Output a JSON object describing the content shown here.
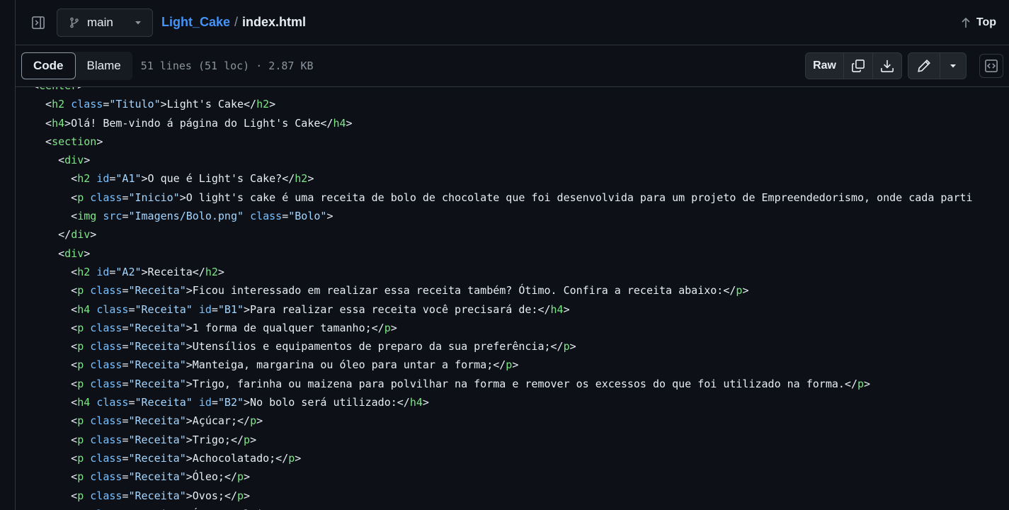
{
  "header": {
    "branch": "main",
    "repo": "Light_Cake",
    "separator": "/",
    "file": "index.html",
    "top_label": "Top"
  },
  "toolbar": {
    "tabs": [
      "Code",
      "Blame"
    ],
    "active_tab": "Code",
    "meta": "51 lines (51 loc) · 2.87 KB",
    "raw_label": "Raw"
  },
  "icons": {
    "sidebar": "sidebar-expand-icon",
    "branch": "git-branch-icon",
    "caret": "triangle-down-icon",
    "top": "arrow-up-icon",
    "copy": "copy-icon",
    "download": "download-icon",
    "edit": "pencil-icon",
    "more": "triangle-down-icon",
    "symbols": "code-square-icon"
  },
  "colors": {
    "background": "#0d1117",
    "tag": "#7ee787",
    "attr": "#79c0ff",
    "string": "#a5d6ff",
    "link": "#4493f8",
    "muted": "#8b949e",
    "border": "#30363d"
  },
  "code_lines": [
    [
      {
        "t": "<",
        "c": "txt"
      },
      {
        "t": "center",
        "c": "tag"
      },
      {
        "t": ">",
        "c": "txt"
      }
    ],
    [
      {
        "t": "  <",
        "c": "txt"
      },
      {
        "t": "h2",
        "c": "tag"
      },
      {
        "t": " ",
        "c": "txt"
      },
      {
        "t": "class",
        "c": "attr"
      },
      {
        "t": "=",
        "c": "txt"
      },
      {
        "t": "\"Titulo\"",
        "c": "str"
      },
      {
        "t": ">Light's Cake</",
        "c": "txt"
      },
      {
        "t": "h2",
        "c": "tag"
      },
      {
        "t": ">",
        "c": "txt"
      }
    ],
    [
      {
        "t": "  <",
        "c": "txt"
      },
      {
        "t": "h4",
        "c": "tag"
      },
      {
        "t": ">Olá! Bem-vindo á página do Light's Cake</",
        "c": "txt"
      },
      {
        "t": "h4",
        "c": "tag"
      },
      {
        "t": ">",
        "c": "txt"
      }
    ],
    [
      {
        "t": "  <",
        "c": "txt"
      },
      {
        "t": "section",
        "c": "tag"
      },
      {
        "t": ">",
        "c": "txt"
      }
    ],
    [
      {
        "t": "    <",
        "c": "txt"
      },
      {
        "t": "div",
        "c": "tag"
      },
      {
        "t": ">",
        "c": "txt"
      }
    ],
    [
      {
        "t": "      <",
        "c": "txt"
      },
      {
        "t": "h2",
        "c": "tag"
      },
      {
        "t": " ",
        "c": "txt"
      },
      {
        "t": "id",
        "c": "attr"
      },
      {
        "t": "=",
        "c": "txt"
      },
      {
        "t": "\"A1\"",
        "c": "str"
      },
      {
        "t": ">O que é Light's Cake?</",
        "c": "txt"
      },
      {
        "t": "h2",
        "c": "tag"
      },
      {
        "t": ">",
        "c": "txt"
      }
    ],
    [
      {
        "t": "      <",
        "c": "txt"
      },
      {
        "t": "p",
        "c": "tag"
      },
      {
        "t": " ",
        "c": "txt"
      },
      {
        "t": "class",
        "c": "attr"
      },
      {
        "t": "=",
        "c": "txt"
      },
      {
        "t": "\"Inicio\"",
        "c": "str"
      },
      {
        "t": ">O light's cake é uma receita de bolo de chocolate que foi desenvolvida para um projeto de Empreendedorismo, onde cada parti",
        "c": "txt"
      }
    ],
    [
      {
        "t": "      <",
        "c": "txt"
      },
      {
        "t": "img",
        "c": "tag"
      },
      {
        "t": " ",
        "c": "txt"
      },
      {
        "t": "src",
        "c": "attr"
      },
      {
        "t": "=",
        "c": "txt"
      },
      {
        "t": "\"Imagens/Bolo.png\"",
        "c": "str"
      },
      {
        "t": " ",
        "c": "txt"
      },
      {
        "t": "class",
        "c": "attr"
      },
      {
        "t": "=",
        "c": "txt"
      },
      {
        "t": "\"Bolo\"",
        "c": "str"
      },
      {
        "t": ">",
        "c": "txt"
      }
    ],
    [
      {
        "t": "    </",
        "c": "txt"
      },
      {
        "t": "div",
        "c": "tag"
      },
      {
        "t": ">",
        "c": "txt"
      }
    ],
    [
      {
        "t": "    <",
        "c": "txt"
      },
      {
        "t": "div",
        "c": "tag"
      },
      {
        "t": ">",
        "c": "txt"
      }
    ],
    [
      {
        "t": "      <",
        "c": "txt"
      },
      {
        "t": "h2",
        "c": "tag"
      },
      {
        "t": " ",
        "c": "txt"
      },
      {
        "t": "id",
        "c": "attr"
      },
      {
        "t": "=",
        "c": "txt"
      },
      {
        "t": "\"A2\"",
        "c": "str"
      },
      {
        "t": ">Receita</",
        "c": "txt"
      },
      {
        "t": "h2",
        "c": "tag"
      },
      {
        "t": ">",
        "c": "txt"
      }
    ],
    [
      {
        "t": "      <",
        "c": "txt"
      },
      {
        "t": "p",
        "c": "tag"
      },
      {
        "t": " ",
        "c": "txt"
      },
      {
        "t": "class",
        "c": "attr"
      },
      {
        "t": "=",
        "c": "txt"
      },
      {
        "t": "\"Receita\"",
        "c": "str"
      },
      {
        "t": ">Ficou interessado em realizar essa receita também? Ótimo. Confira a receita abaixo:</",
        "c": "txt"
      },
      {
        "t": "p",
        "c": "tag"
      },
      {
        "t": ">",
        "c": "txt"
      }
    ],
    [
      {
        "t": "      <",
        "c": "txt"
      },
      {
        "t": "h4",
        "c": "tag"
      },
      {
        "t": " ",
        "c": "txt"
      },
      {
        "t": "class",
        "c": "attr"
      },
      {
        "t": "=",
        "c": "txt"
      },
      {
        "t": "\"Receita\"",
        "c": "str"
      },
      {
        "t": " ",
        "c": "txt"
      },
      {
        "t": "id",
        "c": "attr"
      },
      {
        "t": "=",
        "c": "txt"
      },
      {
        "t": "\"B1\"",
        "c": "str"
      },
      {
        "t": ">Para realizar essa receita você precisará de:</",
        "c": "txt"
      },
      {
        "t": "h4",
        "c": "tag"
      },
      {
        "t": ">",
        "c": "txt"
      }
    ],
    [
      {
        "t": "      <",
        "c": "txt"
      },
      {
        "t": "p",
        "c": "tag"
      },
      {
        "t": " ",
        "c": "txt"
      },
      {
        "t": "class",
        "c": "attr"
      },
      {
        "t": "=",
        "c": "txt"
      },
      {
        "t": "\"Receita\"",
        "c": "str"
      },
      {
        "t": ">1 forma de qualquer tamanho;</",
        "c": "txt"
      },
      {
        "t": "p",
        "c": "tag"
      },
      {
        "t": ">",
        "c": "txt"
      }
    ],
    [
      {
        "t": "      <",
        "c": "txt"
      },
      {
        "t": "p",
        "c": "tag"
      },
      {
        "t": " ",
        "c": "txt"
      },
      {
        "t": "class",
        "c": "attr"
      },
      {
        "t": "=",
        "c": "txt"
      },
      {
        "t": "\"Receita\"",
        "c": "str"
      },
      {
        "t": ">Utensílios e equipamentos de preparo da sua preferência;</",
        "c": "txt"
      },
      {
        "t": "p",
        "c": "tag"
      },
      {
        "t": ">",
        "c": "txt"
      }
    ],
    [
      {
        "t": "      <",
        "c": "txt"
      },
      {
        "t": "p",
        "c": "tag"
      },
      {
        "t": " ",
        "c": "txt"
      },
      {
        "t": "class",
        "c": "attr"
      },
      {
        "t": "=",
        "c": "txt"
      },
      {
        "t": "\"Receita\"",
        "c": "str"
      },
      {
        "t": ">Manteiga, margarina ou óleo para untar a forma;</",
        "c": "txt"
      },
      {
        "t": "p",
        "c": "tag"
      },
      {
        "t": ">",
        "c": "txt"
      }
    ],
    [
      {
        "t": "      <",
        "c": "txt"
      },
      {
        "t": "p",
        "c": "tag"
      },
      {
        "t": " ",
        "c": "txt"
      },
      {
        "t": "class",
        "c": "attr"
      },
      {
        "t": "=",
        "c": "txt"
      },
      {
        "t": "\"Receita\"",
        "c": "str"
      },
      {
        "t": ">Trigo, farinha ou maizena para polvilhar na forma e remover os excessos do que foi utilizado na forma.</",
        "c": "txt"
      },
      {
        "t": "p",
        "c": "tag"
      },
      {
        "t": ">",
        "c": "txt"
      }
    ],
    [
      {
        "t": "      <",
        "c": "txt"
      },
      {
        "t": "h4",
        "c": "tag"
      },
      {
        "t": " ",
        "c": "txt"
      },
      {
        "t": "class",
        "c": "attr"
      },
      {
        "t": "=",
        "c": "txt"
      },
      {
        "t": "\"Receita\"",
        "c": "str"
      },
      {
        "t": " ",
        "c": "txt"
      },
      {
        "t": "id",
        "c": "attr"
      },
      {
        "t": "=",
        "c": "txt"
      },
      {
        "t": "\"B2\"",
        "c": "str"
      },
      {
        "t": ">No bolo será utilizado:</",
        "c": "txt"
      },
      {
        "t": "h4",
        "c": "tag"
      },
      {
        "t": ">",
        "c": "txt"
      }
    ],
    [
      {
        "t": "      <",
        "c": "txt"
      },
      {
        "t": "p",
        "c": "tag"
      },
      {
        "t": " ",
        "c": "txt"
      },
      {
        "t": "class",
        "c": "attr"
      },
      {
        "t": "=",
        "c": "txt"
      },
      {
        "t": "\"Receita\"",
        "c": "str"
      },
      {
        "t": ">Açúcar;</",
        "c": "txt"
      },
      {
        "t": "p",
        "c": "tag"
      },
      {
        "t": ">",
        "c": "txt"
      }
    ],
    [
      {
        "t": "      <",
        "c": "txt"
      },
      {
        "t": "p",
        "c": "tag"
      },
      {
        "t": " ",
        "c": "txt"
      },
      {
        "t": "class",
        "c": "attr"
      },
      {
        "t": "=",
        "c": "txt"
      },
      {
        "t": "\"Receita\"",
        "c": "str"
      },
      {
        "t": ">Trigo;</",
        "c": "txt"
      },
      {
        "t": "p",
        "c": "tag"
      },
      {
        "t": ">",
        "c": "txt"
      }
    ],
    [
      {
        "t": "      <",
        "c": "txt"
      },
      {
        "t": "p",
        "c": "tag"
      },
      {
        "t": " ",
        "c": "txt"
      },
      {
        "t": "class",
        "c": "attr"
      },
      {
        "t": "=",
        "c": "txt"
      },
      {
        "t": "\"Receita\"",
        "c": "str"
      },
      {
        "t": ">Achocolatado;</",
        "c": "txt"
      },
      {
        "t": "p",
        "c": "tag"
      },
      {
        "t": ">",
        "c": "txt"
      }
    ],
    [
      {
        "t": "      <",
        "c": "txt"
      },
      {
        "t": "p",
        "c": "tag"
      },
      {
        "t": " ",
        "c": "txt"
      },
      {
        "t": "class",
        "c": "attr"
      },
      {
        "t": "=",
        "c": "txt"
      },
      {
        "t": "\"Receita\"",
        "c": "str"
      },
      {
        "t": ">Óleo;</",
        "c": "txt"
      },
      {
        "t": "p",
        "c": "tag"
      },
      {
        "t": ">",
        "c": "txt"
      }
    ],
    [
      {
        "t": "      <",
        "c": "txt"
      },
      {
        "t": "p",
        "c": "tag"
      },
      {
        "t": " ",
        "c": "txt"
      },
      {
        "t": "class",
        "c": "attr"
      },
      {
        "t": "=",
        "c": "txt"
      },
      {
        "t": "\"Receita\"",
        "c": "str"
      },
      {
        "t": ">Ovos;</",
        "c": "txt"
      },
      {
        "t": "p",
        "c": "tag"
      },
      {
        "t": ">",
        "c": "txt"
      }
    ],
    [
      {
        "t": "      <",
        "c": "txt"
      },
      {
        "t": "p",
        "c": "tag"
      },
      {
        "t": " ",
        "c": "txt"
      },
      {
        "t": "class",
        "c": "attr"
      },
      {
        "t": "=",
        "c": "txt"
      },
      {
        "t": "\"Receita\"",
        "c": "str"
      },
      {
        "t": ">Água ou leite;</",
        "c": "txt"
      },
      {
        "t": "p",
        "c": "tag"
      },
      {
        "t": ">",
        "c": "txt"
      }
    ]
  ]
}
